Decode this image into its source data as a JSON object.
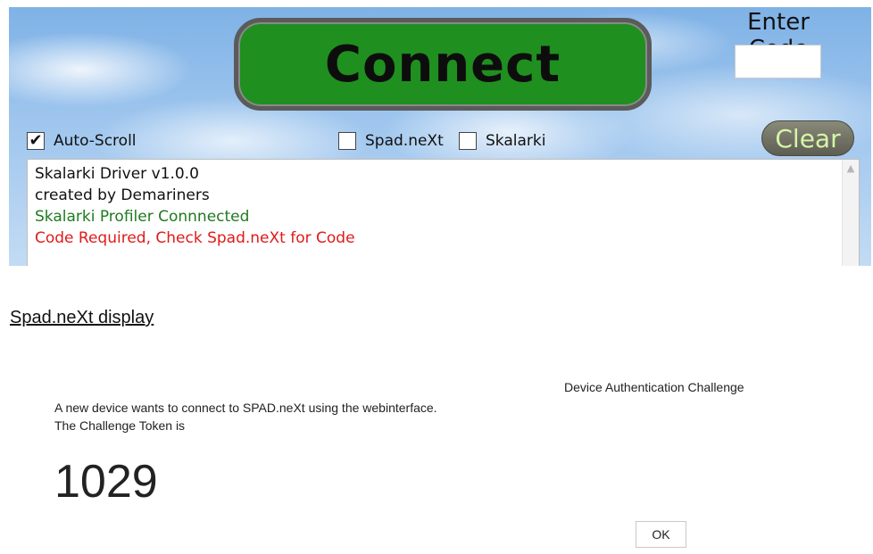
{
  "app": {
    "connect_label": "Connect",
    "enter_code_label": "Enter Code",
    "code_value": "",
    "clear_label": "Clear",
    "checkboxes": [
      {
        "label": "Auto-Scroll",
        "checked": true
      },
      {
        "label": "Spad.neXt",
        "checked": false
      },
      {
        "label": "Skalarki",
        "checked": false
      }
    ],
    "log": [
      {
        "text": "Skalarki Driver v1.0.0",
        "color": "#111111"
      },
      {
        "text": "created by Demariners",
        "color": "#111111"
      },
      {
        "text": "Skalarki Profiler Connnected",
        "color": "#1f7a1f"
      },
      {
        "text": "Code Required, Check Spad.neXt for Code",
        "color": "#e01a1a"
      }
    ]
  },
  "spad": {
    "section_label": "Spad.neXt display",
    "dialog_title": "Device Authentication Challenge",
    "message_line1": "A new device wants to connect to SPAD.neXt using the webinterface.",
    "message_line2": "The Challenge Token is",
    "token": "1029",
    "ok_label": "OK"
  }
}
